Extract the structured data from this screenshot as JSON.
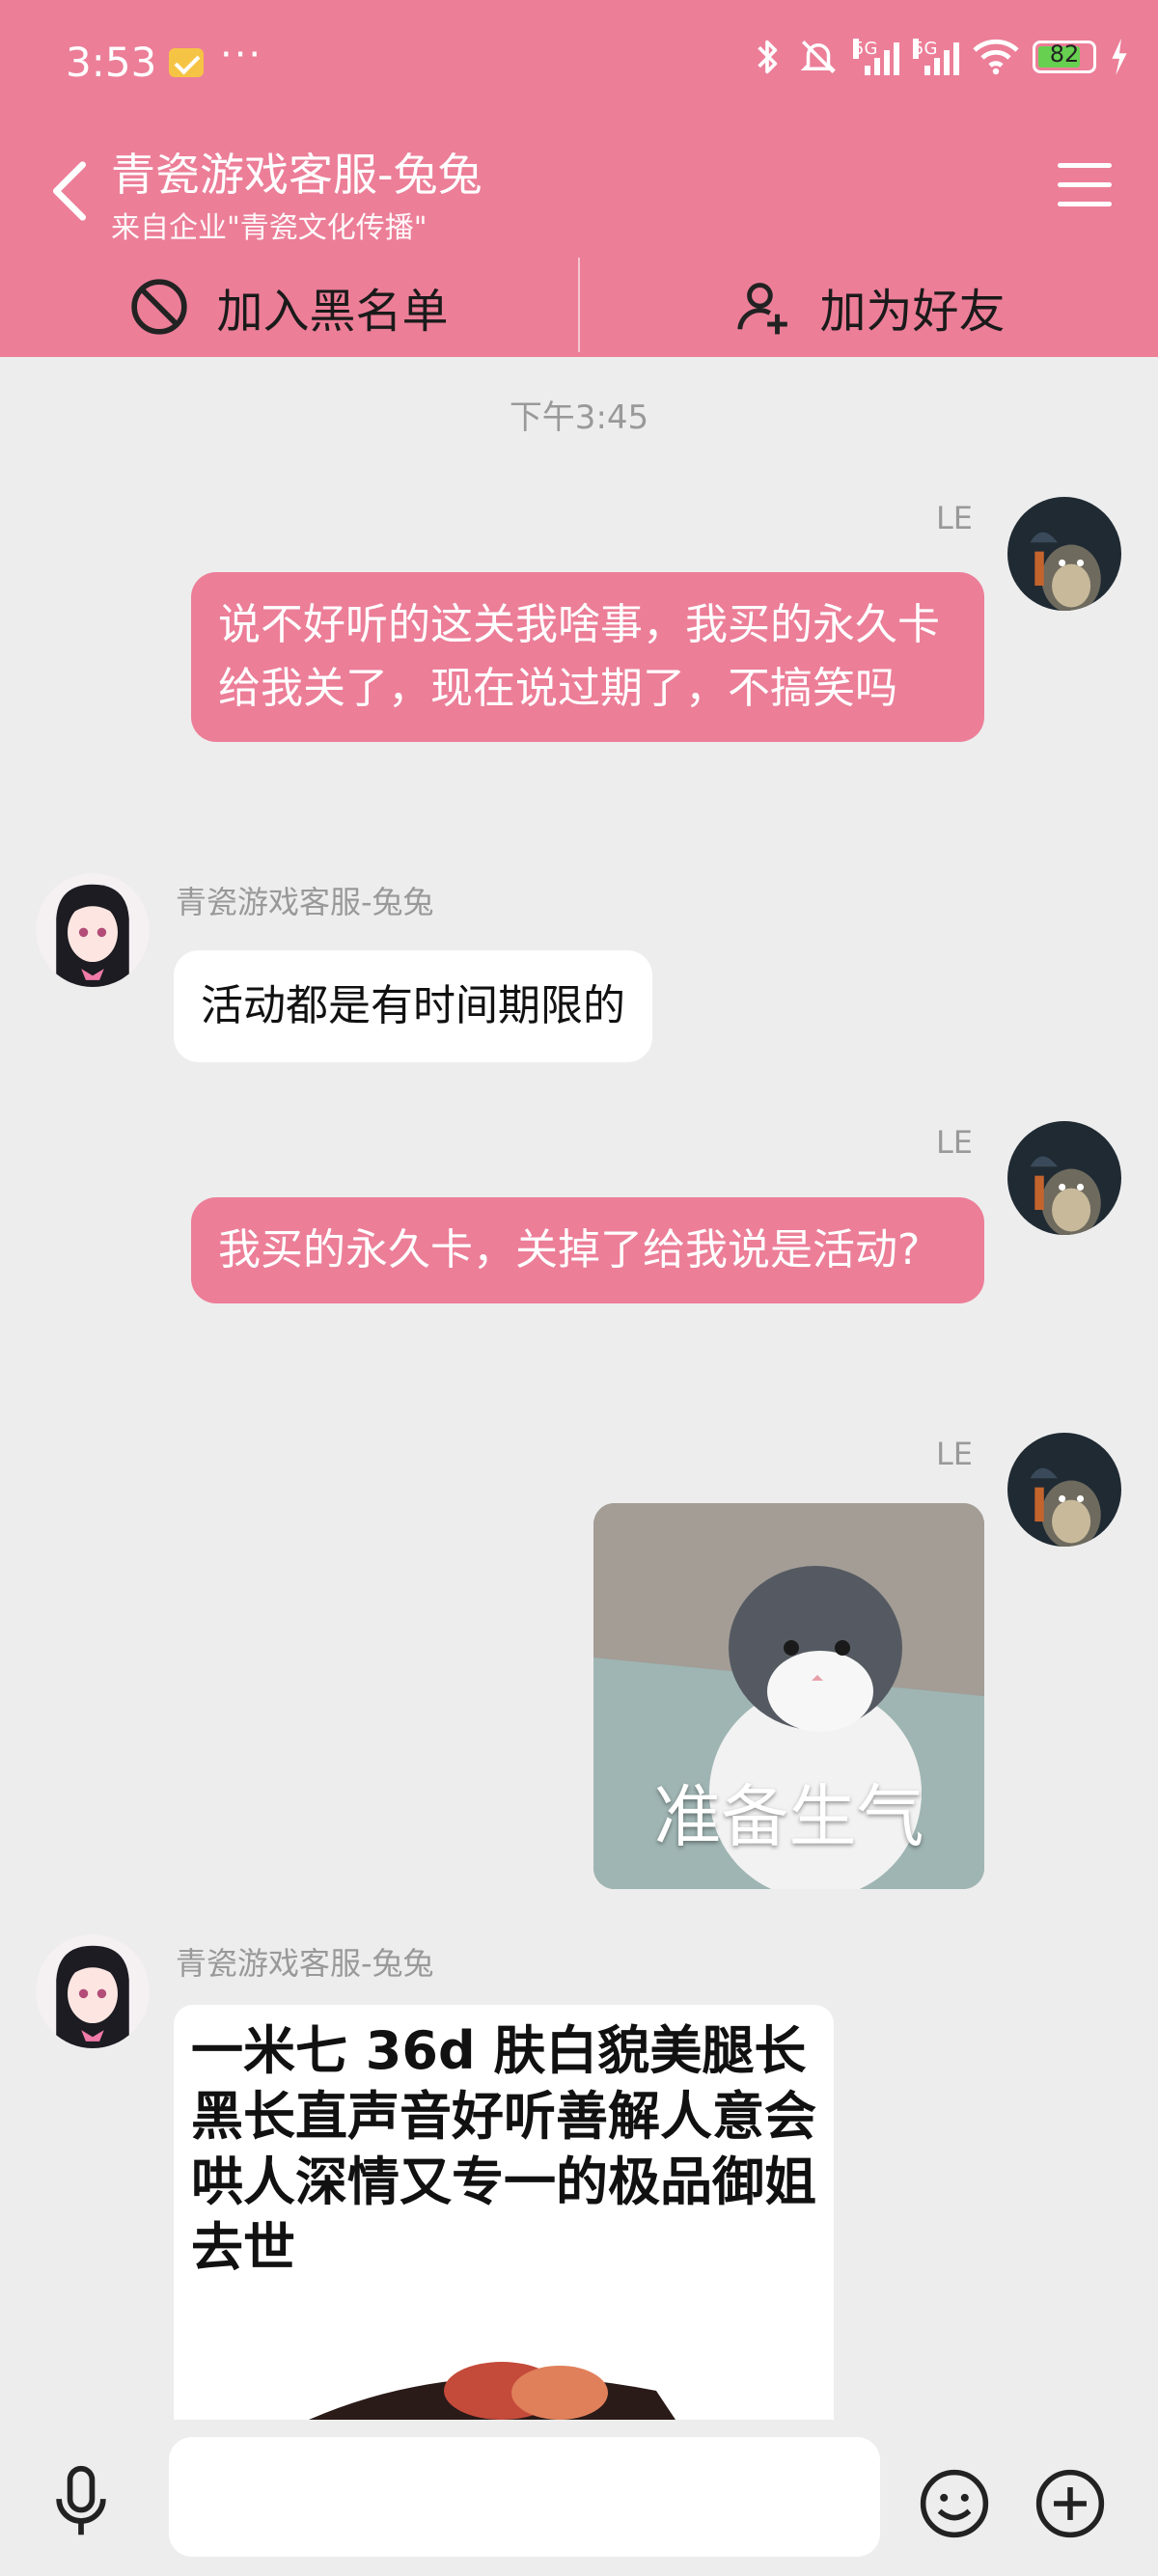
{
  "status_bar": {
    "time": "3:53",
    "dots": "···",
    "network_label_1": "5G",
    "network_label_2": "5G",
    "battery_percent": 82,
    "battery_text": "82"
  },
  "header": {
    "title": "青瓷游戏客服-兔兔",
    "subtitle": "来自企业\"青瓷文化传播\""
  },
  "actions": {
    "blacklist_label": "加入黑名单",
    "add_friend_label": "加为好友"
  },
  "chat": {
    "timestamp": "下午3:45",
    "messages": [
      {
        "sender": "LE",
        "text": "说不好听的这关我啥事，我买的永久卡给我关了，现在说过期了，不搞笑吗"
      },
      {
        "sender": "青瓷游戏客服-兔兔",
        "text": "活动都是有时间期限的"
      },
      {
        "sender": "LE",
        "text": "我买的永久卡，关掉了给我说是活动?"
      },
      {
        "sender": "LE",
        "sticker_text": "准备生气"
      },
      {
        "sender": "青瓷游戏客服-兔兔",
        "meme_text": "一米七 36d 肤白貌美腿长黑长直声音好听善解人意会哄人深情又专一的极品御姐去世"
      }
    ]
  },
  "input": {
    "placeholder": ""
  },
  "colors": {
    "accent": "#ec7e98",
    "background": "#ededed",
    "bubble_other": "#ffffff"
  }
}
